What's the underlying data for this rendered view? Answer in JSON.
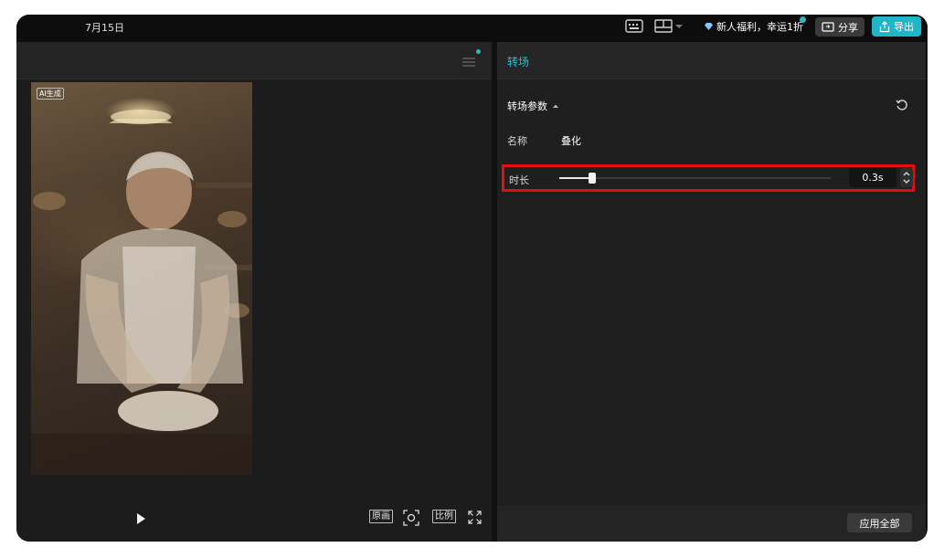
{
  "topbar": {
    "date": "7月15日",
    "promo_text": "新人福利，幸运1折",
    "share_label": "分享",
    "export_label": "导出",
    "accent_color": "#1fb6c8"
  },
  "player": {
    "ai_badge": "AI生成",
    "controls": {
      "original_label": "原画",
      "ratio_label": "比例"
    }
  },
  "panel": {
    "tab_title": "转场",
    "section_title": "转场参数",
    "name_label": "名称",
    "name_value": "叠化",
    "duration_label": "时长",
    "duration_value": "0.3s",
    "duration_slider_fraction": 0.12,
    "apply_all_label": "应用全部"
  },
  "icons": [
    "keyboard-icon",
    "layout-icon",
    "diamond-icon",
    "share-screen-icon",
    "upload-icon",
    "menu-icon",
    "play-icon",
    "focus-icon",
    "fullscreen-icon",
    "reset-icon",
    "chevron-up-icon",
    "stepper-icon"
  ]
}
